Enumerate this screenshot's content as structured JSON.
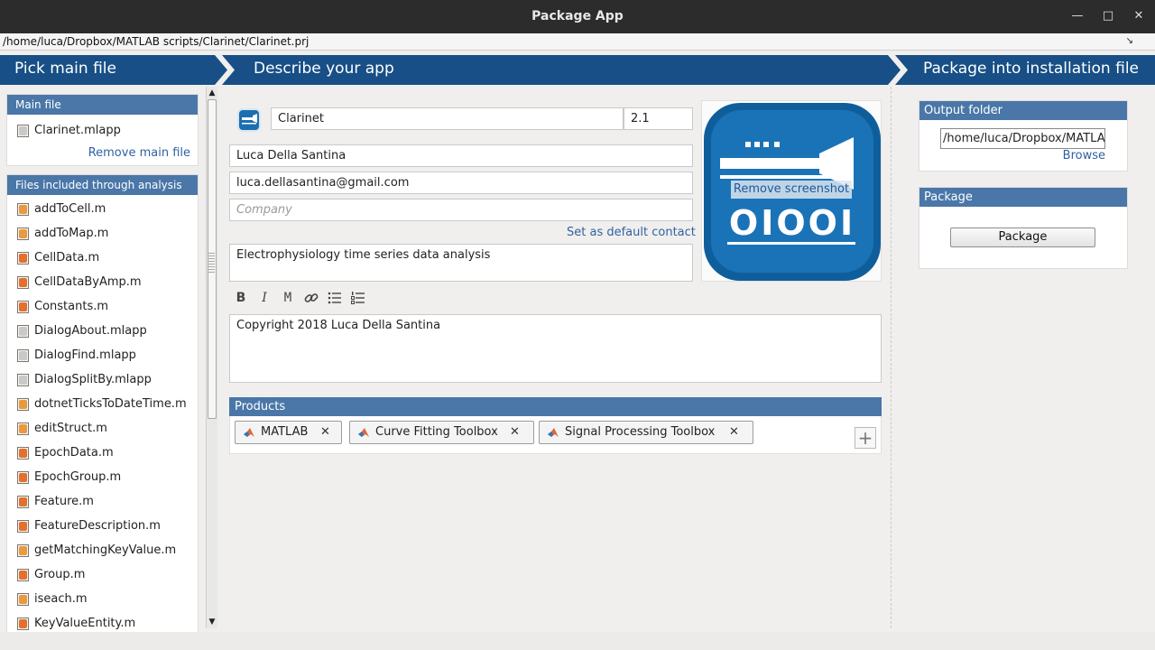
{
  "window": {
    "title": "Package App",
    "project_path": "/home/luca/Dropbox/MATLAB scripts/Clarinet/Clarinet.prj"
  },
  "steps": [
    {
      "label": "Pick main file"
    },
    {
      "label": "Describe your app"
    },
    {
      "label": "Package into installation file"
    }
  ],
  "main_file": {
    "header": "Main file",
    "file": "Clarinet.mlapp",
    "remove_label": "Remove main file"
  },
  "included_files": {
    "header": "Files included through analysis",
    "items": [
      {
        "name": "addToCell.m",
        "icon": "function-file-icon"
      },
      {
        "name": "addToMap.m",
        "icon": "function-file-icon"
      },
      {
        "name": "CellData.m",
        "icon": "class-file-icon"
      },
      {
        "name": "CellDataByAmp.m",
        "icon": "class-file-icon"
      },
      {
        "name": "Constants.m",
        "icon": "class-file-icon"
      },
      {
        "name": "DialogAbout.mlapp",
        "icon": "app-file-icon"
      },
      {
        "name": "DialogFind.mlapp",
        "icon": "app-file-icon"
      },
      {
        "name": "DialogSplitBy.mlapp",
        "icon": "app-file-icon"
      },
      {
        "name": "dotnetTicksToDateTime.m",
        "icon": "function-file-icon"
      },
      {
        "name": "editStruct.m",
        "icon": "function-file-icon"
      },
      {
        "name": "EpochData.m",
        "icon": "class-file-icon"
      },
      {
        "name": "EpochGroup.m",
        "icon": "class-file-icon"
      },
      {
        "name": "Feature.m",
        "icon": "class-file-icon"
      },
      {
        "name": "FeatureDescription.m",
        "icon": "class-file-icon"
      },
      {
        "name": "getMatchingKeyValue.m",
        "icon": "function-file-icon"
      },
      {
        "name": "Group.m",
        "icon": "class-file-icon"
      },
      {
        "name": "iseach.m",
        "icon": "function-file-icon"
      },
      {
        "name": "KeyValueEntity.m",
        "icon": "class-file-icon"
      }
    ]
  },
  "describe": {
    "app_name": "Clarinet",
    "version": "2.1",
    "author": "Luca Della Santina",
    "email": "luca.dellasantina@gmail.com",
    "company_placeholder": "Company",
    "set_default_contact": "Set as default contact",
    "summary": "Electrophysiology time series data analysis",
    "description": "Copyright 2018 Luca Della Santina",
    "remove_screenshot": "Remove screenshot",
    "toolbar": {
      "bold": "B",
      "italic": "I",
      "mono": "M"
    }
  },
  "products": {
    "header": "Products",
    "items": [
      {
        "name": "MATLAB"
      },
      {
        "name": "Curve Fitting Toolbox"
      },
      {
        "name": "Signal Processing Toolbox"
      }
    ]
  },
  "package": {
    "output_header": "Output folder",
    "output_value": "/home/luca/Dropbox/MATLAB",
    "browse_label": "Browse",
    "package_header": "Package",
    "package_button": "Package"
  },
  "colors": {
    "step_bar": "#174f86",
    "section_header": "#4a77a8",
    "link": "#2f62a4"
  }
}
